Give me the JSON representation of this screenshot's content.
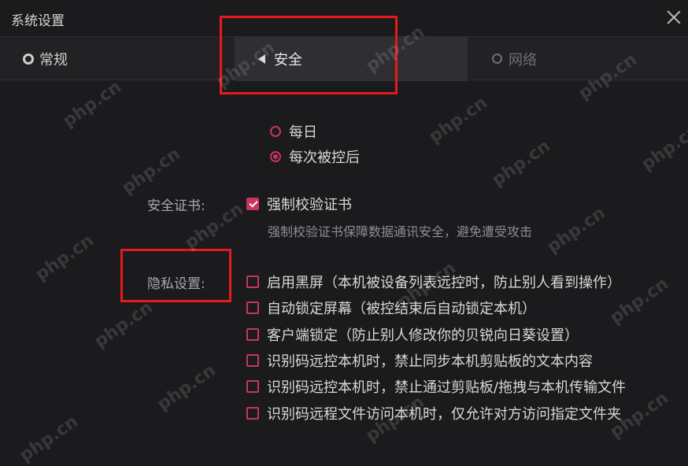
{
  "window": {
    "title": "系统设置"
  },
  "tabs": [
    {
      "label": "常规",
      "icon": "gear-icon"
    },
    {
      "label": "安全",
      "icon": "shield-icon",
      "active": true
    },
    {
      "label": "网络",
      "icon": "globe-icon"
    }
  ],
  "unattended": {
    "options": [
      {
        "label": "每日",
        "checked": false
      },
      {
        "label": "每次被控后",
        "checked": true
      }
    ]
  },
  "certificate": {
    "label": "安全证书:",
    "option": {
      "label": "强制校验证书",
      "checked": true
    },
    "description": "强制校验证书保障数据通讯安全，避免遭受攻击"
  },
  "privacy": {
    "label": "隐私设置:",
    "options": [
      {
        "label": "启用黑屏（本机被设备列表远控时，防止别人看到操作）",
        "checked": false
      },
      {
        "label": "自动锁定屏幕（被控结束后自动锁定本机）",
        "checked": false
      },
      {
        "label": "客户端锁定（防止别人修改你的贝锐向日葵设置）",
        "checked": false
      },
      {
        "label": "识别码远控本机时，禁止同步本机剪贴板的文本内容",
        "checked": false
      },
      {
        "label": "识别码远控本机时，禁止通过剪贴板/拖拽与本机传输文件",
        "checked": false
      },
      {
        "label": "识别码远程文件访问本机时，仅允许对方访问指定文件夹",
        "checked": false
      }
    ]
  },
  "watermark": "php.cn",
  "colors": {
    "accent": "#c8355d",
    "highlight": "#e8191d",
    "background": "#1b1b1d"
  }
}
